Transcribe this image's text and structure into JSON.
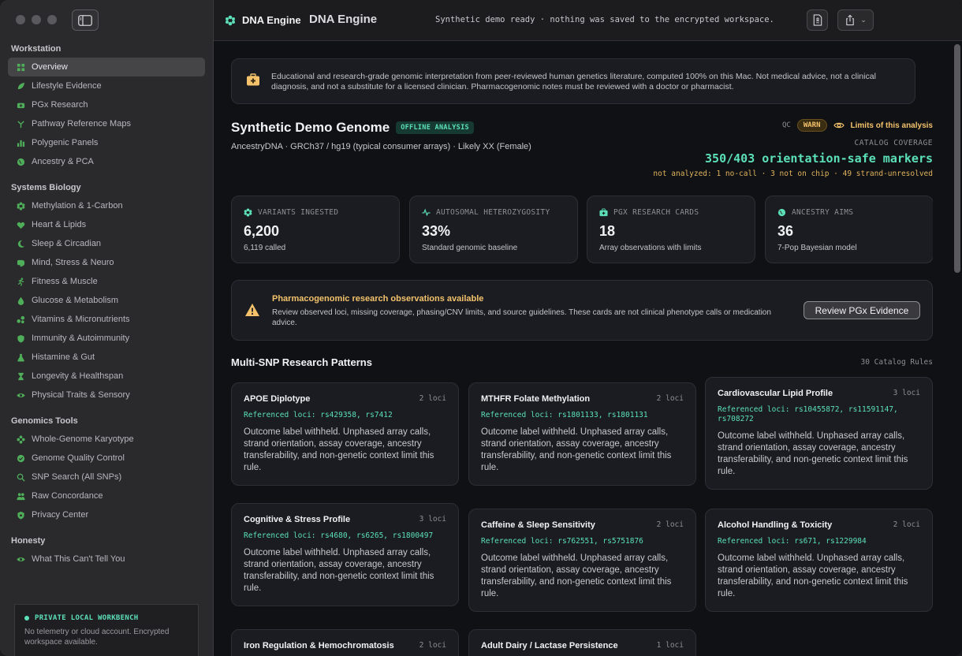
{
  "app": {
    "name": "DNA Engine",
    "window_title": "DNA Engine",
    "status": "Synthetic demo ready · nothing was saved to the encrypted workspace."
  },
  "sidebar": {
    "sections": [
      {
        "title": "Workstation",
        "items": [
          {
            "label": "Overview",
            "icon": "grid-icon",
            "active": true
          },
          {
            "label": "Lifestyle Evidence",
            "icon": "leaf-icon"
          },
          {
            "label": "PGx Research",
            "icon": "pill-icon"
          },
          {
            "label": "Pathway Reference Maps",
            "icon": "branch-icon"
          },
          {
            "label": "Polygenic Panels",
            "icon": "bar-chart-icon"
          },
          {
            "label": "Ancestry & PCA",
            "icon": "globe-icon"
          }
        ]
      },
      {
        "title": "Systems Biology",
        "items": [
          {
            "label": "Methylation & 1-Carbon",
            "icon": "atom-icon"
          },
          {
            "label": "Heart & Lipids",
            "icon": "heart-icon"
          },
          {
            "label": "Sleep & Circadian",
            "icon": "moon-icon"
          },
          {
            "label": "Mind, Stress & Neuro",
            "icon": "brain-icon"
          },
          {
            "label": "Fitness & Muscle",
            "icon": "runner-icon"
          },
          {
            "label": "Glucose & Metabolism",
            "icon": "drop-icon"
          },
          {
            "label": "Vitamins & Micronutrients",
            "icon": "capsule-icon"
          },
          {
            "label": "Immunity & Autoimmunity",
            "icon": "shield-icon"
          },
          {
            "label": "Histamine & Gut",
            "icon": "flask-icon"
          },
          {
            "label": "Longevity & Healthspan",
            "icon": "hourglass-icon"
          },
          {
            "label": "Physical Traits & Sensory",
            "icon": "eye-icon"
          }
        ]
      },
      {
        "title": "Genomics Tools",
        "items": [
          {
            "label": "Whole-Genome Karyotype",
            "icon": "dna-icon"
          },
          {
            "label": "Genome Quality Control",
            "icon": "check-badge-icon"
          },
          {
            "label": "SNP Search (All SNPs)",
            "icon": "search-icon"
          },
          {
            "label": "Raw Concordance",
            "icon": "people-icon"
          },
          {
            "label": "Privacy Center",
            "icon": "lock-shield-icon"
          }
        ]
      },
      {
        "title": "Honesty",
        "items": [
          {
            "label": "What This Can't Tell You",
            "icon": "eye-icon"
          }
        ]
      }
    ],
    "workbench": {
      "title": "PRIVATE LOCAL WORKBENCH",
      "text": "No telemetry or cloud account. Encrypted workspace available."
    }
  },
  "notice": {
    "text": "Educational and research-grade genomic interpretation from peer-reviewed human genetics literature, computed 100% on this Mac. Not medical advice, not a clinical diagnosis, and not a substitute for a licensed clinician. Pharmacogenomic notes must be reviewed with a doctor or pharmacist."
  },
  "genome": {
    "title": "Synthetic Demo Genome",
    "badge": "OFFLINE ANALYSIS",
    "meta": "AncestryDNA · GRCh37 / hg19 (typical consumer arrays) · Likely XX (Female)"
  },
  "qc": {
    "label": "QC",
    "status": "WARN",
    "limits_link": "Limits of this analysis",
    "coverage_label": "CATALOG COVERAGE",
    "coverage_value": "350/403 orientation-safe markers",
    "coverage_note": "not analyzed: 1 no-call · 3 not on chip · 49 strand-unresolved"
  },
  "stats": [
    {
      "label": "VARIANTS INGESTED",
      "icon": "atom-icon",
      "value": "6,200",
      "sub": "6,119 called"
    },
    {
      "label": "AUTOSOMAL HETEROZYGOSITY",
      "icon": "pulse-icon",
      "value": "33%",
      "sub": "Standard genomic baseline"
    },
    {
      "label": "PGX RESEARCH CARDS",
      "icon": "medkit-icon",
      "value": "18",
      "sub": "Array observations with limits"
    },
    {
      "label": "ANCESTRY AIMS",
      "icon": "globe-icon",
      "value": "36",
      "sub": "7-Pop Bayesian model"
    }
  ],
  "pgx_banner": {
    "title": "Pharmacogenomic research observations available",
    "text": "Review observed loci, missing coverage, phasing/CNV limits, and source guidelines. These cards are not clinical phenotype calls or medication advice.",
    "button": "Review PGx Evidence"
  },
  "patterns": {
    "title": "Multi-SNP Research Patterns",
    "count": "30 Catalog Rules",
    "cards": [
      {
        "name": "APOE Diplotype",
        "loci": "2 loci",
        "ref": "Referenced loci: rs429358, rs7412",
        "desc": "Outcome label withheld. Unphased array calls, strand orientation, assay coverage, ancestry transferability, and non-genetic context limit this rule."
      },
      {
        "name": "MTHFR Folate Methylation",
        "loci": "2 loci",
        "ref": "Referenced loci: rs1801133, rs1801131",
        "desc": "Outcome label withheld. Unphased array calls, strand orientation, assay coverage, ancestry transferability, and non-genetic context limit this rule."
      },
      {
        "name": "Cardiovascular Lipid Profile",
        "loci": "3 loci",
        "ref": "Referenced loci: rs10455872, rs11591147, rs708272",
        "desc": "Outcome label withheld. Unphased array calls, strand orientation, assay coverage, ancestry transferability, and non-genetic context limit this rule."
      },
      {
        "name": "Cognitive & Stress Profile",
        "loci": "3 loci",
        "ref": "Referenced loci: rs4680, rs6265, rs1800497",
        "desc": "Outcome label withheld. Unphased array calls, strand orientation, assay coverage, ancestry transferability, and non-genetic context limit this rule."
      },
      {
        "name": "Caffeine & Sleep Sensitivity",
        "loci": "2 loci",
        "ref": "Referenced loci: rs762551, rs5751876",
        "desc": "Outcome label withheld. Unphased array calls, strand orientation, assay coverage, ancestry transferability, and non-genetic context limit this rule."
      },
      {
        "name": "Alcohol Handling & Toxicity",
        "loci": "2 loci",
        "ref": "Referenced loci: rs671, rs1229984",
        "desc": "Outcome label withheld. Unphased array calls, strand orientation, assay coverage, ancestry transferability, and non-genetic context limit this rule."
      },
      {
        "name": "Iron Regulation & Hemochromatosis",
        "loci": "2 loci",
        "ref": "",
        "desc": ""
      },
      {
        "name": "Adult Dairy / Lactase Persistence",
        "loci": "1 loci",
        "ref": "",
        "desc": ""
      }
    ]
  },
  "colors": {
    "accent": "#5ce0b8",
    "warn": "#f3c26b",
    "sidebar_icon": "#4fae5a"
  }
}
